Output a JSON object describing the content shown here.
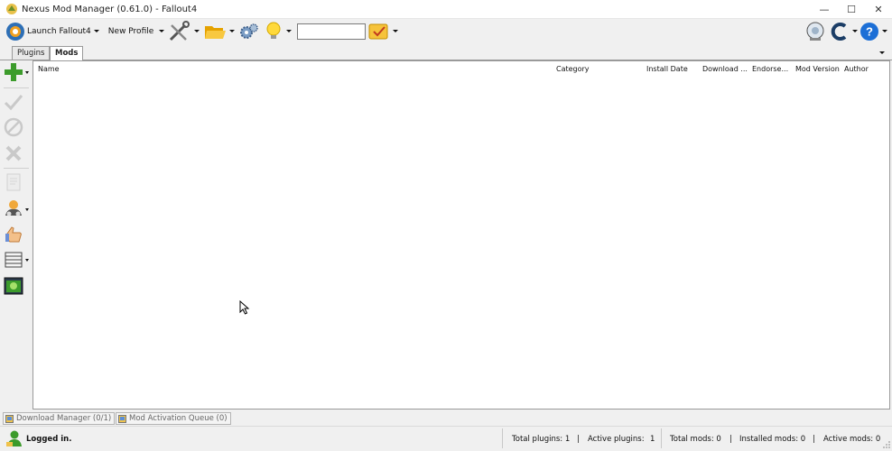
{
  "window": {
    "title": "Nexus Mod Manager (0.61.0) - Fallout4",
    "controls": {
      "minimize": "—",
      "maximize": "☐",
      "close": "✕"
    }
  },
  "toolbar": {
    "launch_label": "Launch Fallout4",
    "profile_label": "New Profile",
    "search_value": "",
    "icons": [
      "launch-game-icon",
      "tools-icon",
      "open-folder-icon",
      "settings-icon",
      "lightbulb-icon",
      "check-update-icon",
      "support-icon",
      "refresh-icon",
      "help-icon"
    ]
  },
  "tabs": [
    {
      "label": "Plugins",
      "active": false
    },
    {
      "label": "Mods",
      "active": true
    }
  ],
  "sidebar": {
    "icons": [
      "add-mod-icon",
      "activate-mod-icon",
      "deactivate-mod-icon",
      "delete-mod-icon",
      "readme-icon",
      "categories-icon",
      "endorse-icon",
      "view-list-icon",
      "screenshot-icon"
    ]
  },
  "mods_table": {
    "columns": [
      "Name",
      "Category",
      "Install Date",
      "Download ...",
      "Endorse...",
      "Mod Version",
      "Author"
    ],
    "rows": []
  },
  "bottom_tabs": [
    {
      "label": "Download Manager (0/1)"
    },
    {
      "label": "Mod Activation Queue (0)"
    }
  ],
  "status": {
    "login": "Logged in.",
    "total_plugins": "Total plugins: 1",
    "active_plugins_label": "Active plugins:",
    "active_plugins_value": "1",
    "total_mods": "Total mods: 0",
    "installed_mods": "Installed mods: 0",
    "active_mods": "Active mods: 0",
    "separator": "|"
  },
  "colors": {
    "accent_green": "#3c9b2b",
    "folder_yellow": "#f2b31a",
    "help_blue": "#1c6fd6"
  }
}
